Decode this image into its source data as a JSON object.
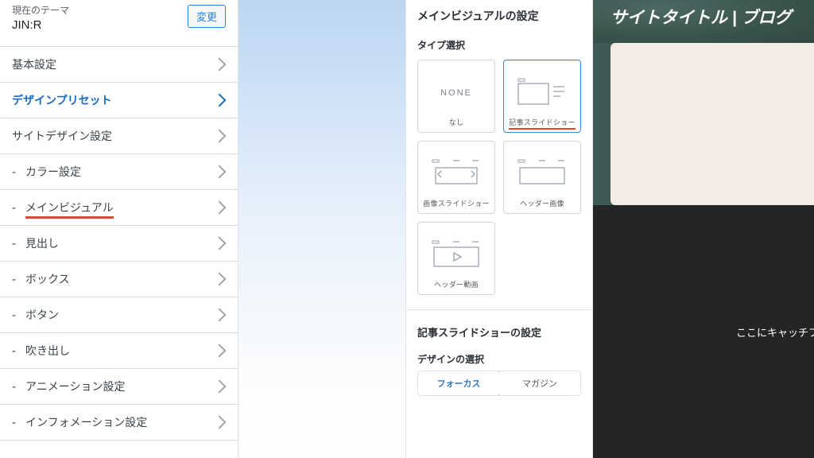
{
  "theme": {
    "label_current": "現在のテーマ",
    "name": "JIN:R",
    "change_button": "変更"
  },
  "menu": {
    "basic": {
      "label": "基本設定"
    },
    "preset": {
      "label": "デザインプリセット"
    },
    "site_design": {
      "label": "サイトデザイン設定"
    },
    "sub": [
      {
        "label": "カラー設定"
      },
      {
        "label": "メインビジュアル",
        "highlight": true
      },
      {
        "label": "見出し"
      },
      {
        "label": "ボックス"
      },
      {
        "label": "ボタン"
      },
      {
        "label": "吹き出し"
      },
      {
        "label": "アニメーション設定"
      },
      {
        "label": "インフォメーション設定"
      }
    ]
  },
  "settings": {
    "title": "メインビジュアルの設定",
    "type_label": "タイプ選択",
    "types": [
      {
        "id": "none",
        "caption": "なし",
        "selected": false,
        "none_text": "NONE"
      },
      {
        "id": "article-slide",
        "caption": "記事スライドショー",
        "selected": true,
        "highlight": true
      },
      {
        "id": "image-slide",
        "caption": "画像スライドショー",
        "selected": false
      },
      {
        "id": "header-image",
        "caption": "ヘッダー画像",
        "selected": false
      },
      {
        "id": "header-video",
        "caption": "ヘッダー動画",
        "selected": false
      }
    ],
    "slideshow_title": "記事スライドショーの設定",
    "design_label": "デザインの選択",
    "design_options": [
      {
        "id": "focus",
        "label": "フォーカス",
        "active": true
      },
      {
        "id": "magazine",
        "label": "マガジン",
        "active": false
      }
    ]
  },
  "preview": {
    "site_title": "サイトタイトル | ブログ",
    "catch": "ここにキャッチフ"
  }
}
